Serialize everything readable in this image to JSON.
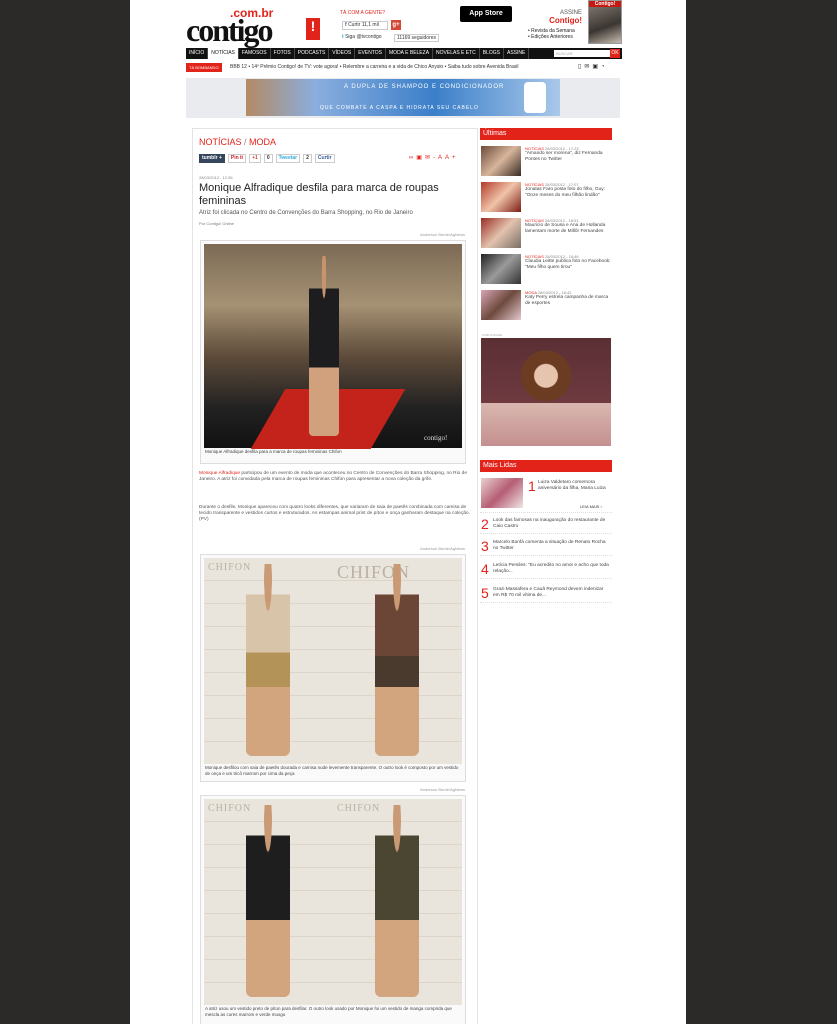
{
  "header": {
    "logo_domain": ".com.br",
    "logo_word": "contigo",
    "logo_mark": "!",
    "social_heading": "TÁ COM A GENTE?",
    "facebook_label": "Curtir",
    "facebook_count": "11,1 mil",
    "twitter_label": "Siga @tvcontigo",
    "twitter_followers": "11169 seguidores",
    "appstore_label": "App Store",
    "assine_label": "ASSINE",
    "assine_brand": "Contigo!",
    "assine_link_1": "• Revista da Semana",
    "assine_link_2": "• Edições Anteriores",
    "cover_label": "Contigo!"
  },
  "nav": {
    "items": [
      "INÍCIO",
      "NOTÍCIAS",
      "FAMOSOS",
      "FOTOS",
      "PODCASTS",
      "VÍDEOS",
      "EVENTOS",
      "MODA E BELEZA",
      "NOVELAS E ETC",
      "BLOGS",
      "ASSINE"
    ],
    "search_placeholder": "BUSCAR",
    "search_button": "OK"
  },
  "ticker": {
    "tag": "TÁ BOMBANDO",
    "text": "BBB 12 • 14º Prêmio Contigo! de TV: vote agora! • Relembre a carreira e a vida de Chico Anysio • Saiba tudo sobre Avenida Brasil"
  },
  "banner": {
    "line1": "A DUPLA DE SHAMPOO E CONDICIONADOR",
    "line2": "QUE COMBATE A CASPA E HIDRATA SEU CABELO"
  },
  "article": {
    "crumb_section": "NOTÍCIAS",
    "crumb_sep": " / ",
    "crumb_sub": "MODA",
    "share": {
      "tumblr": "tumblr +",
      "pinit": "Pin it",
      "gplus": "+1",
      "gplus_count": "0",
      "tweet": "Tweetar",
      "tweet_count": "2",
      "fb": "Curtir"
    },
    "text_size_down": "-A",
    "text_size_up": "A+",
    "date": "28/03/2012 - 12:36",
    "title": "Monique Alfradique desfila para marca de roupas femininas",
    "subtitle": "Atriz foi clicada no Centro de Convenções do Barra Shopping, no Rio de Janeiro",
    "byline": "Por Contigo! Online",
    "photo_credit": "Anderson Borde/AgNews",
    "photo1_caption": "Monique Alfradique desfila para a marca de roupas femininas Chifon",
    "para1_name": "Monique Alfradique",
    "para1_rest": " participou de um evento de moda que aconteceu no Centro de Convenções do Barra Shopping, no Rio de Janeiro. A atriz foi convidada pela marca de roupas femininas Chifon para apresentar a nova coleção da grife.",
    "para2": "Durante o desfile, Monique apareceu com quatro looks diferentes, que variaram de saia de paetês combinada com camisa de tecido transparente e vestidos curtos e estruturados. As estampas animal print de píton e onça ganharam destaque na coleção. (PV)",
    "photo2_caption": "Monique desfilou com saia de paetês dourada e camisa nude levemente transparente. O outro look é composto por um vestido de onça e um tricô marrom por cima da peça",
    "photo3_caption": "A atriz usou um vestido preto de píton para desfilar. O outro look usado por Monique foi um vestido de manga comprida que mescla as cores marrom e verde musgo",
    "watermark": "CHIFON",
    "site_watermark": "contigo!"
  },
  "sidebar": {
    "ultimas_title": "Últimas",
    "ultimas": [
      {
        "cat": "NOTÍCIAS",
        "date": "28/03/2012 - 17:23",
        "text": "\"Amando ser morena\", diz Fernanda Pontes no Twitter"
      },
      {
        "cat": "NOTÍCIAS",
        "date": "28/03/2012 - 17:07",
        "text": "Jonatas Faro posta foto do filho, Guy: \"Onze meses do meu filhão lindão\""
      },
      {
        "cat": "NOTÍCIAS",
        "date": "28/03/2012 - 16:51",
        "text": "Mauricio de Sousa e Ana de Hollanda lamentam morte de Millôr Fernandes"
      },
      {
        "cat": "NOTÍCIAS",
        "date": "28/03/2012 - 16:46",
        "text": "Claudia Leitte publica foto no Facebook: \"Meu filho quem tirou\""
      },
      {
        "cat": "MODA",
        "date": "28/03/2012 - 16:42",
        "text": "Katy Perry estrela campanha de marca de esportes"
      }
    ],
    "pub_label": "PUBLICIDADE",
    "mais_title": "Mais Lidas",
    "mais_first_num": "1",
    "mais_first_text": "Luiza Valdetaro comemora aniversário da filha, Maria Luiza",
    "mais_more": "LEIA MAIS ›",
    "mais": [
      {
        "num": "2",
        "text": "Look das famosas na inauguração do restaurante de Caio Castro"
      },
      {
        "num": "3",
        "text": "Marcelo Bonfá comenta a situação de Renato Rocha no Twitter"
      },
      {
        "num": "4",
        "text": "Letícia Persiles: \"Eu acredito no amor e acho que toda relação..."
      },
      {
        "num": "5",
        "text": "Grazi Massafera e Cauã Reymond devem indenizar em R$ 70 mil vítima de..."
      }
    ]
  },
  "colors": {
    "accent": "#e2231a",
    "background": "#2b2a28"
  }
}
